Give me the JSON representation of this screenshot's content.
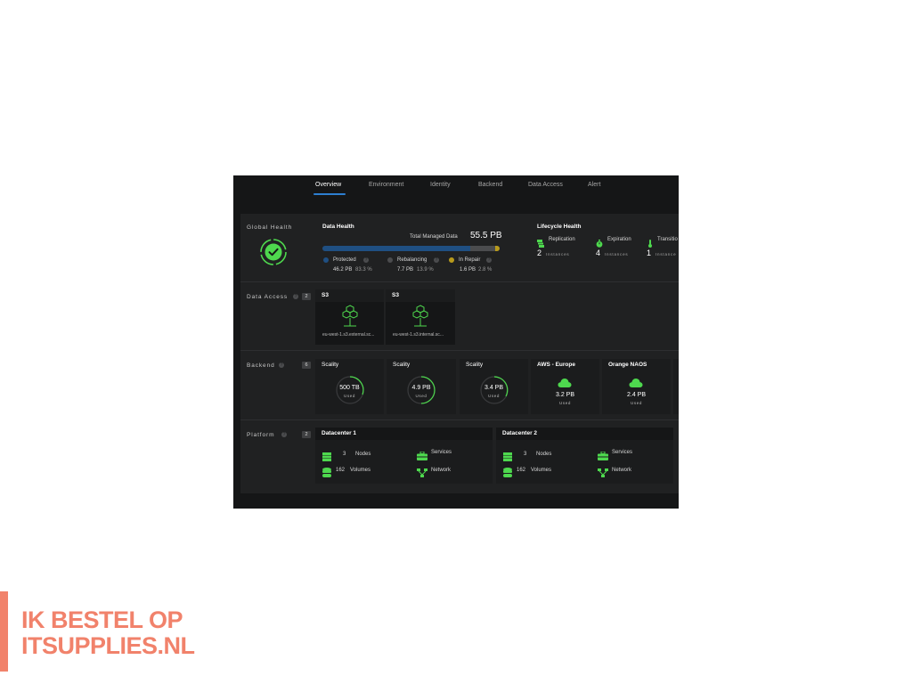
{
  "tabs": [
    {
      "label": "Overview",
      "active": true
    },
    {
      "label": "Environment",
      "active": false
    },
    {
      "label": "Identity",
      "active": false
    },
    {
      "label": "Backend",
      "active": false
    },
    {
      "label": "Data Access",
      "active": false
    },
    {
      "label": "Alert",
      "active": false
    }
  ],
  "global_health": {
    "label": "Global Health",
    "status": "healthy",
    "icon": "check-circle-icon"
  },
  "data_health": {
    "title": "Data Health",
    "total_label": "Total Managed Data",
    "total_value": "55.5 PB",
    "segments": [
      {
        "label": "Protected",
        "value": "46.2 PB",
        "percent": "83.3 %",
        "fraction": 0.833,
        "color": "#1f4f82"
      },
      {
        "label": "Rebalancing",
        "value": "7.7 PB",
        "percent": "13.9 %",
        "fraction": 0.139,
        "color": "#4b4c4e"
      },
      {
        "label": "In Repair",
        "value": "1.6 PB",
        "percent": "2.8 %",
        "fraction": 0.028,
        "color": "#b79a1c"
      }
    ]
  },
  "lifecycle": {
    "title": "Lifecycle Health",
    "items": [
      {
        "label": "Replication",
        "count": "2",
        "unit": "Instances",
        "icon": "replication-icon"
      },
      {
        "label": "Expiration",
        "count": "4",
        "unit": "Instances",
        "icon": "timer-icon"
      },
      {
        "label": "Transitio",
        "count": "1",
        "unit": "Instance",
        "icon": "thermometer-icon"
      }
    ]
  },
  "data_access": {
    "label": "Data Access",
    "count": "2",
    "endpoints": [
      {
        "title": "S3",
        "host": "eu-west-1.s3.external.sc...",
        "icon": "cubes-network-icon"
      },
      {
        "title": "S3",
        "host": "eu-west-1.s3.internal.sc...",
        "icon": "cubes-network-icon"
      }
    ]
  },
  "backend": {
    "label": "Backend",
    "count": "6",
    "locations": [
      {
        "title": "Scality",
        "value": "500 TB",
        "sub": "Used",
        "kind": "gauge"
      },
      {
        "title": "Scality",
        "value": "4.9 PB",
        "sub": "Used",
        "kind": "gauge"
      },
      {
        "title": "Scality",
        "value": "3.4 PB",
        "sub": "Used",
        "kind": "gauge"
      },
      {
        "title": "AWS - Europe",
        "value": "3.2 PB",
        "sub": "Used",
        "kind": "cloud"
      },
      {
        "title": "Orange NAOS",
        "value": "2.4 PB",
        "sub": "Used",
        "kind": "cloud"
      }
    ]
  },
  "platform": {
    "label": "Platform",
    "count": "2",
    "datacenters": [
      {
        "title": "Datacenter 1",
        "nodes": "3",
        "nodes_label": "Nodes",
        "volumes": "162",
        "volumes_label": "Volumes",
        "services_label": "Services",
        "network_label": "Network"
      },
      {
        "title": "Datacenter 2",
        "nodes": "3",
        "nodes_label": "Nodes",
        "volumes": "162",
        "volumes_label": "Volumes",
        "services_label": "Services",
        "network_label": "Network"
      }
    ]
  },
  "help_glyph": "?",
  "watermark": {
    "line1": "IK BESTEL OP",
    "line2": "ITSUPPLIES.NL"
  },
  "colors": {
    "app_bg": "#151617",
    "panel_bg": "#202122",
    "accent_green": "#4ed84e",
    "tab_active": "#2d7fd1"
  }
}
